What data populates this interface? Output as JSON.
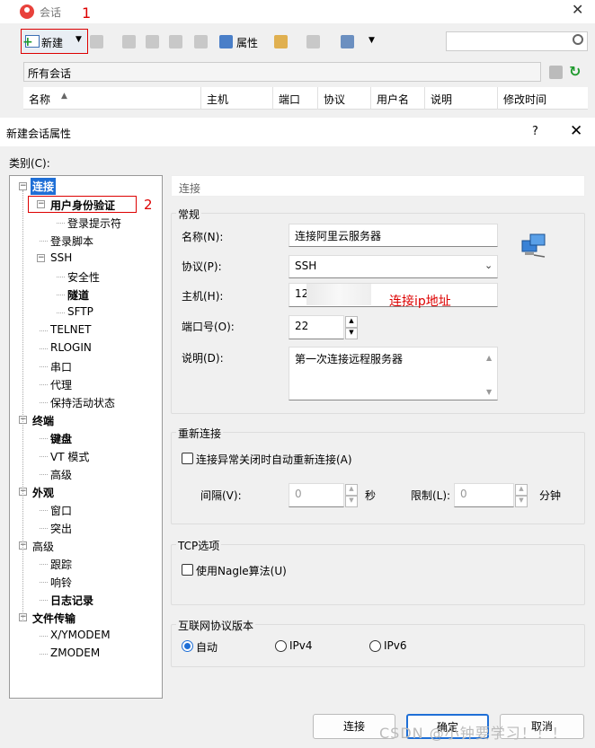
{
  "session_window": {
    "title": "会话",
    "toolbar": {
      "new_label": "新建",
      "properties_label": "属性",
      "search_placeholder": ""
    },
    "all_sessions": "所有会话",
    "columns": [
      "名称",
      "主机",
      "端口",
      "协议",
      "用户名",
      "说明",
      "修改时间"
    ]
  },
  "annotations": {
    "one": "1",
    "two": "2",
    "ip": "连接ip地址"
  },
  "dialog": {
    "title": "新建会话属性",
    "help": "?",
    "category_label": "类别(C):",
    "tree": [
      {
        "label": "连接",
        "bold": true,
        "level": 0,
        "expander": "-"
      },
      {
        "label": "用户身份验证",
        "bold": true,
        "level": 1,
        "expander": "-"
      },
      {
        "label": "登录提示符",
        "bold": false,
        "level": 2
      },
      {
        "label": "登录脚本",
        "bold": false,
        "level": 1
      },
      {
        "label": "SSH",
        "bold": false,
        "level": 1,
        "expander": "-"
      },
      {
        "label": "安全性",
        "bold": false,
        "level": 2
      },
      {
        "label": "隧道",
        "bold": true,
        "level": 2
      },
      {
        "label": "SFTP",
        "bold": false,
        "level": 2
      },
      {
        "label": "TELNET",
        "bold": false,
        "level": 1
      },
      {
        "label": "RLOGIN",
        "bold": false,
        "level": 1
      },
      {
        "label": "串口",
        "bold": false,
        "level": 1
      },
      {
        "label": "代理",
        "bold": false,
        "level": 1
      },
      {
        "label": "保持活动状态",
        "bold": false,
        "level": 1
      },
      {
        "label": "终端",
        "bold": true,
        "level": 0,
        "expander": "-"
      },
      {
        "label": "键盘",
        "bold": true,
        "level": 1
      },
      {
        "label": "VT 模式",
        "bold": false,
        "level": 1
      },
      {
        "label": "高级",
        "bold": false,
        "level": 1
      },
      {
        "label": "外观",
        "bold": true,
        "level": 0,
        "expander": "-"
      },
      {
        "label": "窗口",
        "bold": false,
        "level": 1
      },
      {
        "label": "突出",
        "bold": false,
        "level": 1
      },
      {
        "label": "高级",
        "bold": false,
        "level": 0,
        "expander": "-"
      },
      {
        "label": "跟踪",
        "bold": false,
        "level": 1
      },
      {
        "label": "响铃",
        "bold": false,
        "level": 1
      },
      {
        "label": "日志记录",
        "bold": true,
        "level": 1
      },
      {
        "label": "文件传输",
        "bold": true,
        "level": 0,
        "expander": "-"
      },
      {
        "label": "X/YMODEM",
        "bold": false,
        "level": 1
      },
      {
        "label": "ZMODEM",
        "bold": false,
        "level": 1
      }
    ],
    "panel_header": "连接",
    "general": {
      "group": "常规",
      "name_label": "名称(N):",
      "name_value": "连接阿里云服务器",
      "protocol_label": "协议(P):",
      "protocol_value": "SSH",
      "host_label": "主机(H):",
      "host_value": "120",
      "port_label": "端口号(O):",
      "port_value": "22",
      "desc_label": "说明(D):",
      "desc_value": "第一次连接远程服务器"
    },
    "reconnect": {
      "group": "重新连接",
      "checkbox_label": "连接异常关闭时自动重新连接(A)",
      "interval_label": "间隔(V):",
      "interval_value": "0",
      "interval_unit": "秒",
      "limit_label": "限制(L):",
      "limit_value": "0",
      "limit_unit": "分钟"
    },
    "tcp": {
      "group": "TCP选项",
      "nagle_label": "使用Nagle算法(U)"
    },
    "ip_version": {
      "group": "互联网协议版本",
      "auto": "自动",
      "ipv4": "IPv4",
      "ipv6": "IPv6"
    },
    "buttons": {
      "connect": "连接",
      "ok": "确定",
      "cancel": "取消"
    },
    "watermark": "CSDN @小钟要学习！！！"
  }
}
